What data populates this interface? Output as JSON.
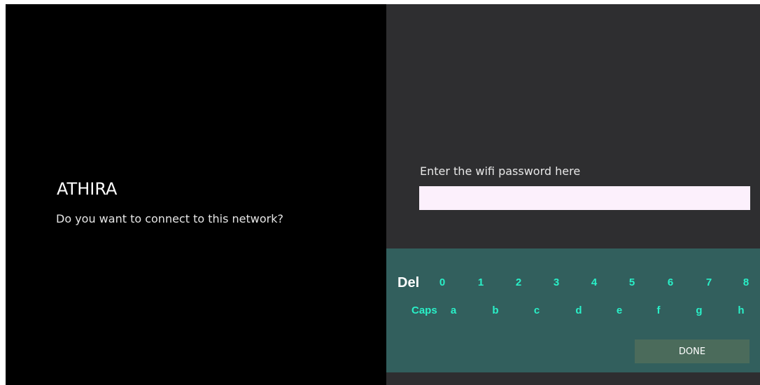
{
  "network": {
    "name": "ATHIRA",
    "question": "Do you want to connect to this network?"
  },
  "password": {
    "label": "Enter the wifi password here",
    "value": "",
    "placeholder": ""
  },
  "keyboard": {
    "delete_label": "Del",
    "caps_label": "Caps",
    "number_keys": [
      "0",
      "1",
      "2",
      "3",
      "4",
      "5",
      "6",
      "7",
      "8"
    ],
    "letter_keys": [
      "a",
      "b",
      "c",
      "d",
      "e",
      "f",
      "g",
      "h"
    ],
    "done_label": "DONE"
  },
  "colors": {
    "left_background": "#000000",
    "right_background": "#2e2e30",
    "input_background": "#fcf0fc",
    "keyboard_background": "#325f5d",
    "key_text": "#29f0c8",
    "done_button_background": "#4b6b5b"
  }
}
